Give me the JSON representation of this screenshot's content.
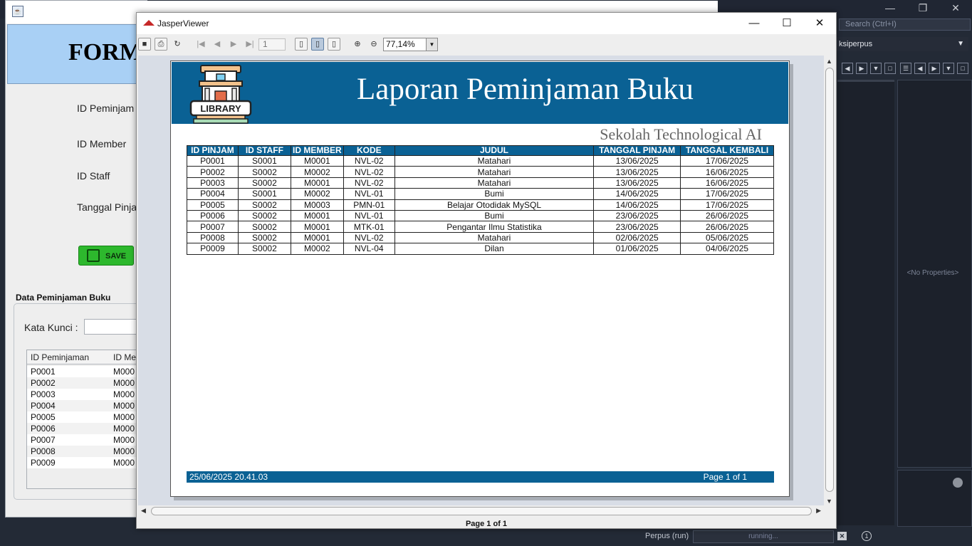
{
  "ide": {
    "search_placeholder": "Search (Ctrl+I)",
    "combo_value": "ksiperpus",
    "no_properties": "<No Properties>",
    "status_task": "Perpus (run)",
    "status_progress": "running..."
  },
  "form": {
    "header_title": "FORM",
    "labels": {
      "id_peminjaman": "ID Peminjam",
      "id_member": "ID Member",
      "id_staff": "ID Staff",
      "tanggal_pinjam": "Tanggal Pinja"
    },
    "save_label": "SAVE",
    "section_title": "Data Peminjaman Buku",
    "search_label": "Kata Kunci :",
    "table": {
      "headers": [
        "ID Peminjaman",
        "ID Me"
      ],
      "rows": [
        [
          "P0001",
          "M000"
        ],
        [
          "P0002",
          "M000"
        ],
        [
          "P0003",
          "M000"
        ],
        [
          "P0004",
          "M000"
        ],
        [
          "P0005",
          "M000"
        ],
        [
          "P0006",
          "M000"
        ],
        [
          "P0007",
          "M000"
        ],
        [
          "P0008",
          "M000"
        ],
        [
          "P0009",
          "M000"
        ]
      ]
    }
  },
  "viewer": {
    "window_title": "JasperViewer",
    "page_number": "1",
    "zoom": "77,14%",
    "status": "Page 1 of 1"
  },
  "report": {
    "logo_text": "LIBRARY",
    "title": "Laporan Peminjaman Buku",
    "school": "Sekolah Technological AI",
    "columns": [
      "ID PINJAM",
      "ID STAFF",
      "ID MEMBER",
      "KODE",
      "JUDUL",
      "TANGGAL PINJAM",
      "TANGGAL KEMBALI"
    ],
    "rows": [
      [
        "P0001",
        "S0001",
        "M0001",
        "NVL-02",
        "Matahari",
        "13/06/2025",
        "17/06/2025"
      ],
      [
        "P0002",
        "S0002",
        "M0002",
        "NVL-02",
        "Matahari",
        "13/06/2025",
        "16/06/2025"
      ],
      [
        "P0003",
        "S0002",
        "M0001",
        "NVL-02",
        "Matahari",
        "13/06/2025",
        "16/06/2025"
      ],
      [
        "P0004",
        "S0001",
        "M0002",
        "NVL-01",
        "Bumi",
        "14/06/2025",
        "17/06/2025"
      ],
      [
        "P0005",
        "S0002",
        "M0003",
        "PMN-01",
        "Belajar Otodidak MySQL",
        "14/06/2025",
        "17/06/2025"
      ],
      [
        "P0006",
        "S0002",
        "M0001",
        "NVL-01",
        "Bumi",
        "23/06/2025",
        "26/06/2025"
      ],
      [
        "P0007",
        "S0002",
        "M0001",
        "MTK-01",
        "Pengantar Ilmu Statistika",
        "23/06/2025",
        "26/06/2025"
      ],
      [
        "P0008",
        "S0002",
        "M0001",
        "NVL-02",
        "Matahari",
        "02/06/2025",
        "05/06/2025"
      ],
      [
        "P0009",
        "S0002",
        "M0002",
        "NVL-04",
        "Dilan",
        "01/06/2025",
        "04/06/2025"
      ]
    ],
    "footer_date": "25/06/2025 20.41.03",
    "footer_page": "Page 1 of 1"
  }
}
